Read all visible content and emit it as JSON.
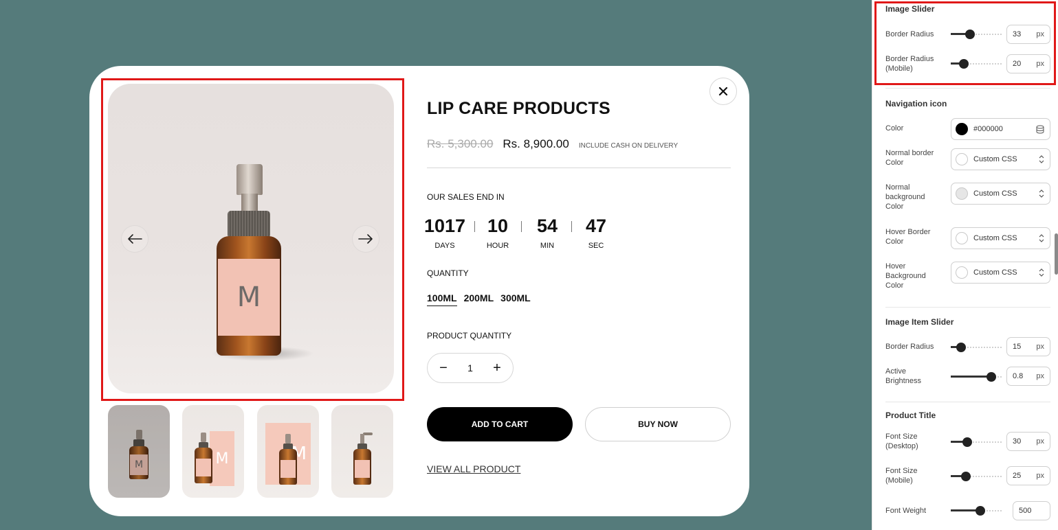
{
  "colors": {
    "canvas_bg": "#557b7b",
    "highlight": "#e01818",
    "accent": "#000000"
  },
  "modal": {
    "close_icon": "close-icon",
    "gallery": {
      "prev_icon": "arrow-left-icon",
      "next_icon": "arrow-right-icon",
      "main_label_letter": "M",
      "thumbnails": [
        {
          "name": "thumb-1",
          "letter": "M"
        },
        {
          "name": "thumb-2",
          "letter": "M"
        },
        {
          "name": "thumb-3",
          "letter": "M"
        },
        {
          "name": "thumb-4",
          "letter": ""
        }
      ]
    },
    "product": {
      "title": "LIP CARE PRODUCTS",
      "old_price": "Rs. 5,300.00",
      "new_price": "Rs. 8,900.00",
      "price_note": "INCLUDE CASH ON DELIVERY",
      "sales_label": "OUR SALES END IN",
      "countdown": [
        {
          "value": "1017",
          "label": "DAYS"
        },
        {
          "value": "10",
          "label": "HOUR"
        },
        {
          "value": "54",
          "label": "MIN"
        },
        {
          "value": "47",
          "label": "SEC"
        }
      ],
      "quantity_label": "QUANTITY",
      "variants": [
        "100ML",
        "200ML",
        "300ML"
      ],
      "selected_variant": "100ML",
      "product_quantity_label": "PRODUCT QUANTITY",
      "quantity_value": "1",
      "add_to_cart": "ADD TO CART",
      "buy_now": "BUY NOW",
      "view_all": "VIEW ALL PRODUCT"
    }
  },
  "panel": {
    "image_slider": {
      "title": "Image Slider",
      "border_radius_label": "Border Radius",
      "border_radius_value": "33",
      "border_radius_unit": "px",
      "border_radius_mobile_label": "Border Radius (Mobile)",
      "border_radius_mobile_value": "20",
      "border_radius_mobile_unit": "px"
    },
    "navigation_icon": {
      "title": "Navigation icon",
      "color_label": "Color",
      "color_value": "#000000",
      "normal_border_label": "Normal border Color",
      "normal_border_value": "Custom CSS",
      "normal_bg_label": "Normal background Color",
      "normal_bg_value": "Custom CSS",
      "hover_border_label": "Hover Border Color",
      "hover_border_value": "Custom CSS",
      "hover_bg_label": "Hover Background Color",
      "hover_bg_value": "Custom CSS"
    },
    "image_item_slider": {
      "title": "Image Item Slider",
      "border_radius_label": "Border Radius",
      "border_radius_value": "15",
      "border_radius_unit": "px",
      "active_brightness_label": "Active Brightness",
      "active_brightness_value": "0.8",
      "active_brightness_unit": "px"
    },
    "product_title": {
      "title": "Product Title",
      "font_size_desktop_label": "Font Size (Desktop)",
      "font_size_desktop_value": "30",
      "font_size_desktop_unit": "px",
      "font_size_mobile_label": "Font Size (Mobile)",
      "font_size_mobile_value": "25",
      "font_size_mobile_unit": "px",
      "font_weight_label": "Font Weight",
      "font_weight_value": "500"
    },
    "sliders": {
      "border_radius": 0.38,
      "border_radius_mobile": 0.26,
      "item_border_radius": 0.2,
      "active_brightness": 0.8,
      "font_size_desktop": 0.33,
      "font_size_mobile": 0.3,
      "font_weight": 0.58
    }
  }
}
